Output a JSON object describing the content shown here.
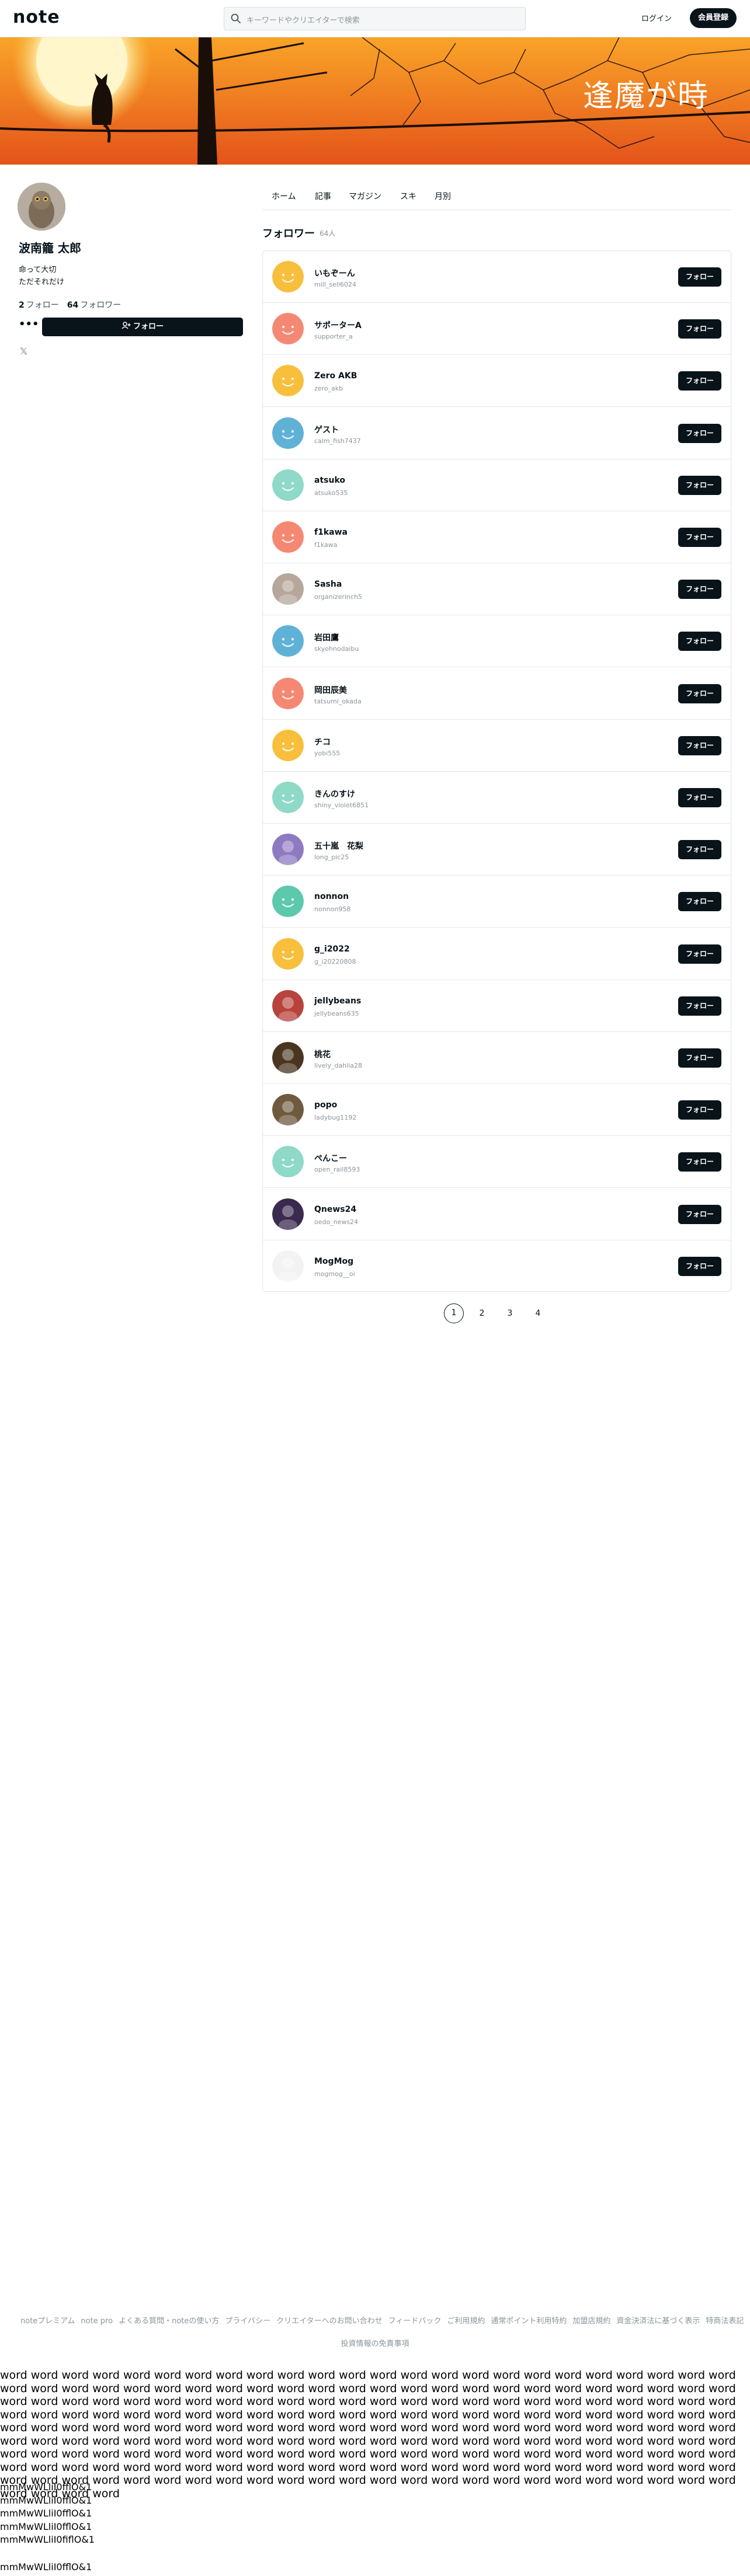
{
  "header": {
    "logo": "note",
    "search_placeholder": "キーワードやクリエイターで検索",
    "login": "ログイン",
    "signup": "会員登録"
  },
  "banner": {
    "title": "逢魔が時"
  },
  "profile": {
    "name": "波南籠 太郎",
    "bio_line1": "命って大切",
    "bio_line2": "ただそれだけ",
    "following_count": "2",
    "following_label": "フォロー",
    "followers_count": "64",
    "followers_label": "フォロワー",
    "follow_button": "フォロー",
    "more": "•••",
    "x_icon": "𝕏"
  },
  "tabs": [
    "ホーム",
    "記事",
    "マガジン",
    "スキ",
    "月別"
  ],
  "section": {
    "title": "フォロワー",
    "count": "64人"
  },
  "followers": [
    {
      "name": "いもぞーん",
      "id": "mill_sell6024",
      "color": "#f8bf3d",
      "kind": "smile"
    },
    {
      "name": "サポーターA",
      "id": "supporter_a",
      "color": "#f58873",
      "kind": "smile"
    },
    {
      "name": "Zero AKB",
      "id": "zero_akb",
      "color": "#f8bf3d",
      "kind": "smile"
    },
    {
      "name": "ゲスト",
      "id": "calm_fish7437",
      "color": "#5fb2d6",
      "kind": "smile"
    },
    {
      "name": "atsuko",
      "id": "atsuko535",
      "color": "#8ed9c7",
      "kind": "smile"
    },
    {
      "name": "f1kawa",
      "id": "f1kawa",
      "color": "#f58873",
      "kind": "smile"
    },
    {
      "name": "Sasha",
      "id": "organizerinch5",
      "color": "#b7a79a",
      "kind": "photo"
    },
    {
      "name": "岩田鷹",
      "id": "skyohnodaibu",
      "color": "#5fb2d6",
      "kind": "smile"
    },
    {
      "name": "岡田辰美",
      "id": "tatsumi_okada",
      "color": "#f58873",
      "kind": "smile"
    },
    {
      "name": "チコ",
      "id": "yobi555",
      "color": "#f8bf3d",
      "kind": "smile"
    },
    {
      "name": "きんのすけ",
      "id": "shiny_violet6851",
      "color": "#8ed9c7",
      "kind": "smile"
    },
    {
      "name": "五十嵐　花梨",
      "id": "long_pic25",
      "color": "#8e7ac0",
      "kind": "photo"
    },
    {
      "name": "nonnon",
      "id": "nonnon958",
      "color": "#5cc8ae",
      "kind": "smile"
    },
    {
      "name": "g_i2022",
      "id": "g_i20220808",
      "color": "#f8bf3d",
      "kind": "smile"
    },
    {
      "name": "jellybeans",
      "id": "jellybeans635",
      "color": "#b8433c",
      "kind": "photo"
    },
    {
      "name": "桃花",
      "id": "lively_dahlia28",
      "color": "#4a3520",
      "kind": "photo"
    },
    {
      "name": "popo",
      "id": "ladybug1192",
      "color": "#6f5a3e",
      "kind": "photo"
    },
    {
      "name": "ぺんこー",
      "id": "open_rail8593",
      "color": "#8ed9c7",
      "kind": "smile"
    },
    {
      "name": "Qnews24",
      "id": "oedo_news24",
      "color": "#3a2a4f",
      "kind": "photo"
    },
    {
      "name": "MogMog",
      "id": "mogmog__oi",
      "color": "#f3f3f3",
      "kind": "photo"
    }
  ],
  "follow_label": "フォロー",
  "pagination": [
    "1",
    "2",
    "3",
    "4"
  ],
  "footer": {
    "links": [
      "noteプレミアム",
      "note pro",
      "よくある質問・noteの使い方",
      "プライバシー",
      "クリエイターへのお問い合わせ",
      "フィードバック",
      "ご利用規約",
      "通常ポイント利用特約",
      "加盟店規約",
      "資金決済法に基づく表示",
      "特商法表記"
    ],
    "law": "投資情報の免責事項"
  },
  "measure": {
    "words": "word word word word word word word word word word word word word word word word word word word word word word word word word word word word word word word word word word word word word word word word word word word word word word word word word word word word word word word word word word word word word word word word word word word word word word word word word word word word word word word word word word word word word word word word word word word word word word word word word word word word word word word word word word word word word word word word word word word word word word word word word word word word word word word word word word word word word word word word word word word word word word word word word word word word word word word word word word word word word word word word word word word word word word word word word word word word word word word word word word word word word word word word word word word word word word word word word word word word word word word word word word word word word word word word word word word word word word word word word word word word",
    "glyph_lines": [
      "mmMwWLliI0fflO&1",
      "mmMwWLliI0fflO&1",
      "mmMwWLliI0fflO&1",
      "mmMwWLliI0fflO&1",
      "mmMwWLliI0fiflO&1"
    ],
    "glyph_last": "mmMwWLliI0fflO&1"
  },
  "colors": {
    "primary": "#08131a",
    "muted": "#8c9399",
    "banner": "#f26b1d"
  }
}
